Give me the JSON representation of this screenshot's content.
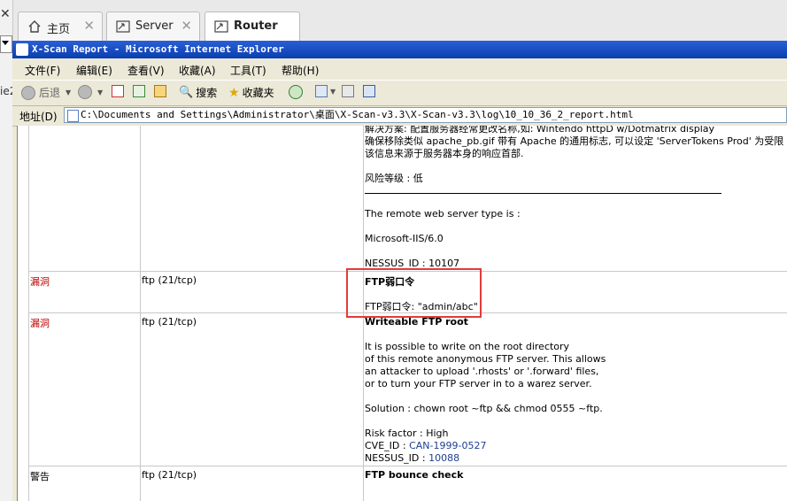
{
  "outer_tabs": [
    {
      "label": "主页"
    },
    {
      "label": "Server"
    },
    {
      "label": "Router"
    }
  ],
  "left_stub": {
    "close": "✕",
    "fragment": "ie2"
  },
  "window": {
    "title": "X-Scan Report - Microsoft Internet Explorer",
    "menu": [
      "文件(F)",
      "编辑(E)",
      "查看(V)",
      "收藏(A)",
      "工具(T)",
      "帮助(H)"
    ],
    "toolbar": {
      "back": "后退",
      "search": "搜索",
      "favorites": "收藏夹"
    },
    "address": {
      "label": "地址(D)",
      "value": "C:\\Documents and Settings\\Administrator\\桌面\\X-Scan-v3.3\\X-Scan-v3.3\\log\\10_10_36_2_report.html"
    }
  },
  "report": {
    "top": {
      "lines": [
        "解决方案: 配置服务器经常更改名称,如: Wintendo httpD w/Dotmatrix display",
        "确保移除类似 apache_pb.gif 带有 Apache 的通用标志, 可以设定 'ServerTokens Prod' 为受限",
        "该信息来源于服务器本身的响应首部."
      ],
      "risk": "风险等级 : 低",
      "type_label": "The remote web server type is :",
      "type_value": "Microsoft-IIS/6.0",
      "nessus": "NESSUS_ID : 10107"
    },
    "rows": [
      {
        "severity": "漏洞",
        "port": "ftp (21/tcp)",
        "title": "FTP弱口令",
        "detail": "FTP弱口令: \"admin/abc\""
      },
      {
        "severity": "漏洞",
        "port": "ftp (21/tcp)",
        "title": "Writeable FTP root",
        "desc": [
          "It is possible to write on the root directory",
          "of this remote anonymous FTP server. This allows",
          "an attacker to upload '.rhosts' or '.forward' files,",
          "or to turn your FTP server in to a warez server."
        ],
        "solution": "Solution : chown root ~ftp && chmod 0555 ~ftp.",
        "risk": "Risk factor : High",
        "cve_label": "CVE_ID : ",
        "cve": "CAN-1999-0527",
        "nessus_label": "NESSUS_ID : ",
        "nessus": "10088"
      },
      {
        "severity": "警告",
        "port": "ftp (21/tcp)",
        "title": "FTP bounce check"
      }
    ]
  }
}
